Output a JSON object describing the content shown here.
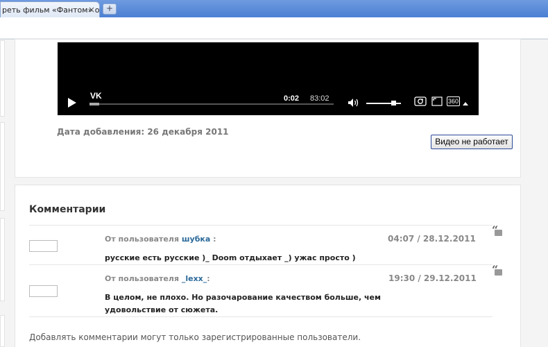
{
  "browser": {
    "tab_title": "реть фильм «Фантом» о",
    "tab_close": "×",
    "new_tab": "+"
  },
  "player": {
    "brand": "VK",
    "time_current": "0:02",
    "time_total": "83:02",
    "quality_label": "360",
    "progress_fraction": 0.04,
    "volume_fraction": 0.86
  },
  "video_info": {
    "date_added": "Дата добавления: 26 декабря 2011",
    "broken_button_label": "Видео не работает"
  },
  "comments": {
    "title": "Комментарии",
    "items": [
      {
        "prefix": "От пользователя",
        "user": "шубка",
        "suffix": " :",
        "datetime": "04:07 / 28.12.2011",
        "text": "русские есть русские )_ Doom отдыхает _) ужас просто )"
      },
      {
        "prefix": "От пользователя",
        "user": "_lexx_",
        "suffix": ":",
        "datetime": "19:30 / 29.12.2011",
        "text": "В целом, не плохо. Но разочарование качеством больше, чем удовольствие от сюжета."
      }
    ],
    "footer_note": "Добавлять комментарии могут только зарегистрированные пользователи."
  }
}
